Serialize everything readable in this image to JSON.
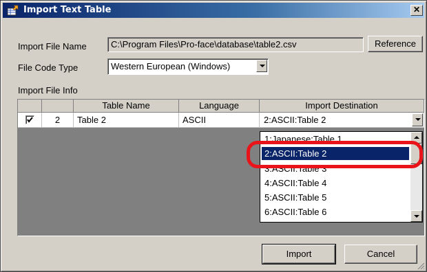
{
  "window": {
    "title": "Import Text Table",
    "close_glyph": "✕"
  },
  "import_file": {
    "label": "Import File Name",
    "path": "C:\\Program Files\\Pro-face\\database\\table2.csv",
    "reference_button": "Reference"
  },
  "file_code": {
    "label": "File Code Type",
    "value": "Western European (Windows)"
  },
  "import_info": {
    "label": "Import File Info",
    "columns": [
      "Table Name",
      "Language",
      "Import Destination"
    ],
    "rows": [
      {
        "checked": true,
        "number": "2",
        "table_name": "Table 2",
        "language": "ASCII",
        "destination": "2:ASCII:Table 2"
      }
    ]
  },
  "destination_dropdown": {
    "options": [
      "1:Japanese:Table 1",
      "2:ASCII:Table 2",
      "3:ASCII:Table 3",
      "4:ASCII:Table 4",
      "5:ASCII:Table 5",
      "6:ASCII:Table 6"
    ],
    "selected_index": 1
  },
  "buttons": {
    "import": "Import",
    "cancel": "Cancel"
  },
  "colors": {
    "title_bar": "#0a246a",
    "selection": "#0a246a",
    "highlight_ring": "#e8141a",
    "dialog_face": "#d4d0c8"
  }
}
